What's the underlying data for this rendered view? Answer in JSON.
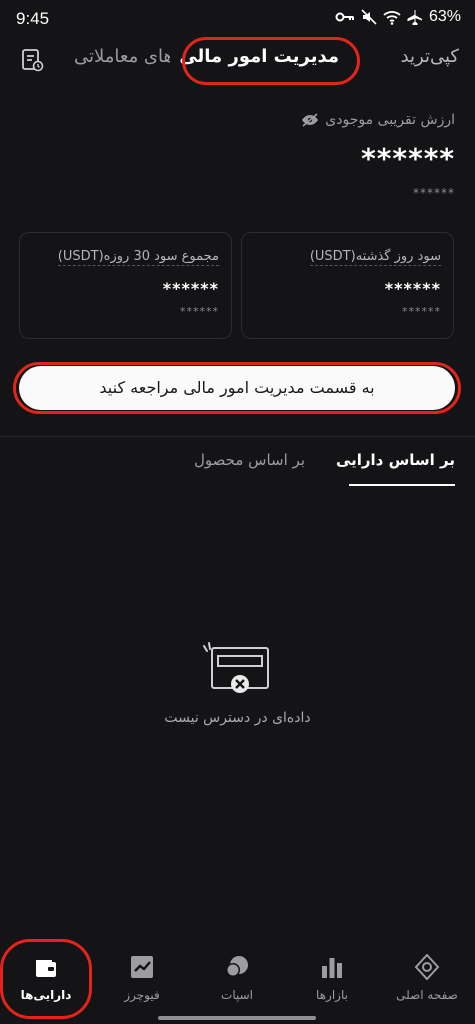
{
  "status_bar": {
    "time": "9:45",
    "battery": "63%"
  },
  "tabs": [
    {
      "label": "کپی‌ترید"
    },
    {
      "label": "مدیریت امور مالی"
    },
    {
      "label": "ربات‌های معاملاتی"
    }
  ],
  "summary": {
    "label": "ارزش تقریبی موجودی",
    "value": "******",
    "sub_value": "******"
  },
  "cards": {
    "yesterday": {
      "title": "سود روز گذشته(USDT)",
      "value": "******",
      "sub": "******"
    },
    "thirty_day": {
      "title": "مجموع سود 30 روزه(USDT)",
      "value": "******",
      "sub": "******"
    }
  },
  "cta": {
    "label": "به قسمت مدیریت امور مالی مراجعه کنید"
  },
  "subtabs": {
    "by_asset": "بر اساس دارایی",
    "by_product": "بر اساس محصول"
  },
  "empty_state": {
    "text": "داده‌ای در دسترس نیست"
  },
  "bottom_nav": {
    "home": "صفحه اصلی",
    "markets": "بازارها",
    "spot": "اسپات",
    "futures": "فیوچرز",
    "assets": "دارایی‌ها"
  },
  "colors": {
    "background": "#141416",
    "highlight": "#e3241a",
    "cta_bg": "#fafafa"
  }
}
